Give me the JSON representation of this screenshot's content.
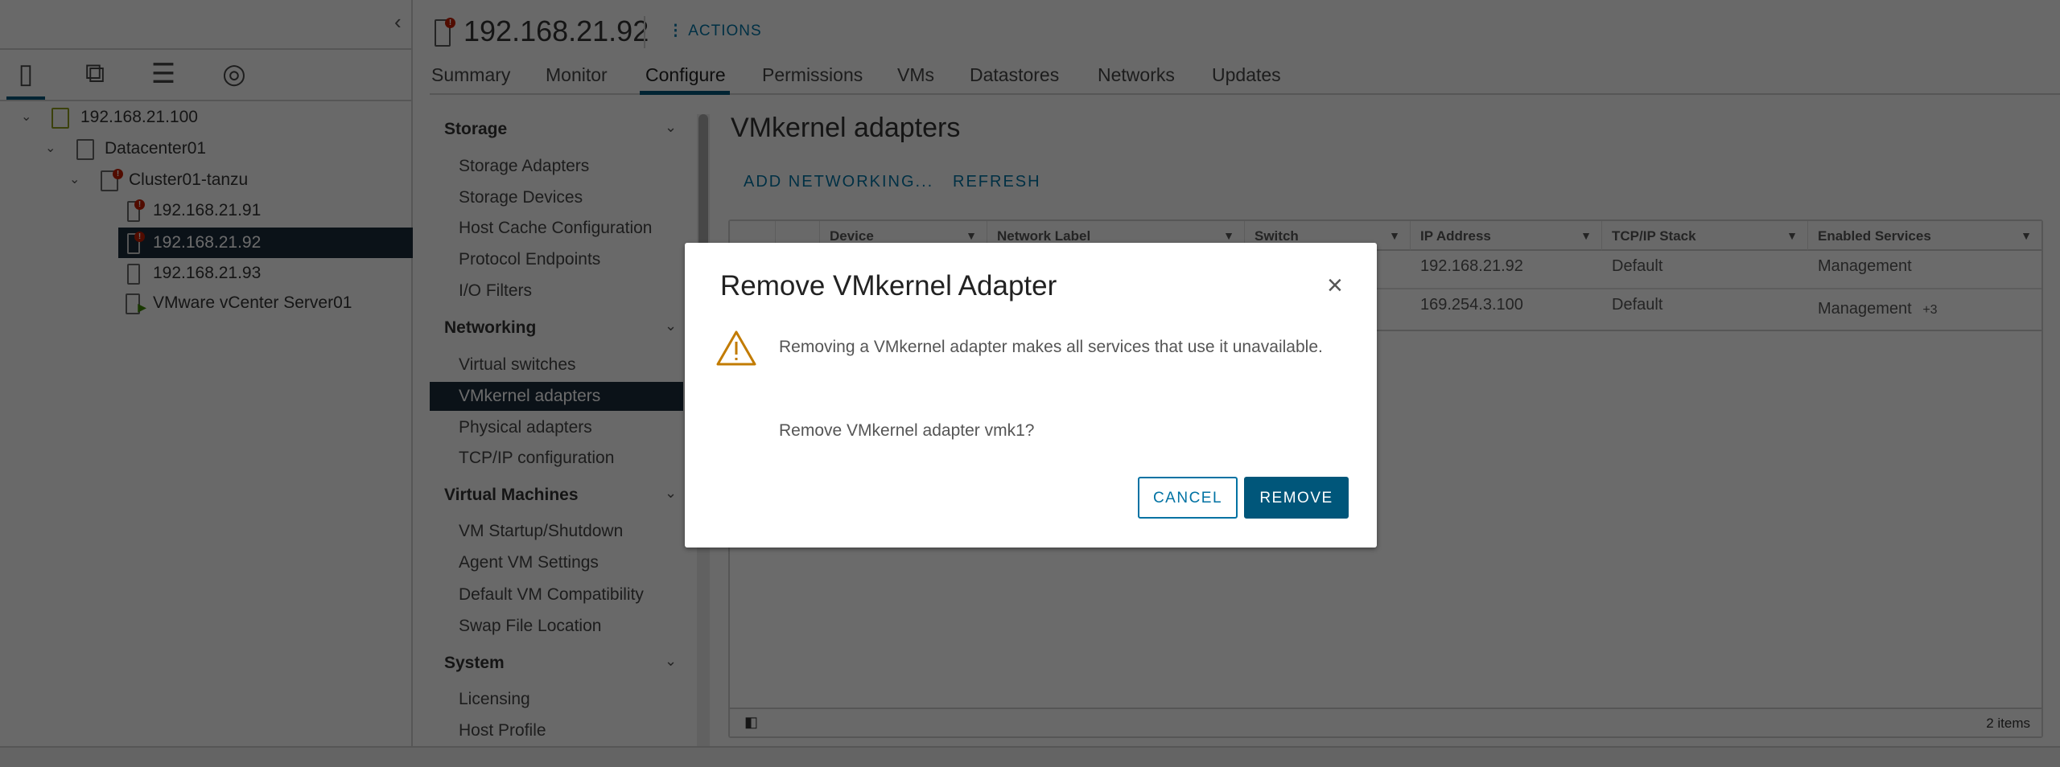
{
  "nav": {
    "collapse_icon": "chevron-left-icon",
    "view_icons": [
      "hosts-clusters-icon",
      "vms-templates-icon",
      "storage-icon",
      "networking-icon"
    ],
    "tree": [
      {
        "label": "192.168.21.100",
        "icon": "vcenter-icon"
      },
      {
        "label": "Datacenter01",
        "icon": "datacenter-icon"
      },
      {
        "label": "Cluster01-tanzu",
        "icon": "cluster-icon"
      },
      {
        "label": "192.168.21.91",
        "icon": "host-alert-icon"
      },
      {
        "label": "192.168.21.92",
        "icon": "host-alert-icon",
        "selected": true
      },
      {
        "label": "192.168.21.93",
        "icon": "host-icon"
      },
      {
        "label": "VMware vCenter Server01",
        "icon": "vm-icon"
      }
    ]
  },
  "header": {
    "title": "192.168.21.92",
    "actions": "ACTIONS"
  },
  "tabs": [
    "Summary",
    "Monitor",
    "Configure",
    "Permissions",
    "VMs",
    "Datastores",
    "Networks",
    "Updates"
  ],
  "active_tab": "Configure",
  "config_menu": {
    "storage": {
      "title": "Storage",
      "items": [
        "Storage Adapters",
        "Storage Devices",
        "Host Cache Configuration",
        "Protocol Endpoints",
        "I/O Filters"
      ]
    },
    "networking": {
      "title": "Networking",
      "items": [
        "Virtual switches",
        "VMkernel adapters",
        "Physical adapters",
        "TCP/IP configuration"
      ]
    },
    "vms": {
      "title": "Virtual Machines",
      "items": [
        "VM Startup/Shutdown",
        "Agent VM Settings",
        "Default VM Compatibility",
        "Swap File Location"
      ]
    },
    "system": {
      "title": "System",
      "items": [
        "Licensing",
        "Host Profile"
      ]
    }
  },
  "content": {
    "title": "VMkernel adapters",
    "add_networking": "ADD NETWORKING...",
    "refresh": "REFRESH",
    "columns": [
      "Device",
      "Network Label",
      "Switch",
      "IP Address",
      "TCP/IP Stack",
      "Enabled Services"
    ],
    "rows": [
      {
        "ip": "192.168.21.92",
        "stack": "Default",
        "services": "Management"
      },
      {
        "ip": "169.254.3.100",
        "stack": "Default",
        "services": "Management",
        "more": "+3"
      }
    ],
    "footer": "2 items"
  },
  "dialog": {
    "title": "Remove VMkernel Adapter",
    "message": "Removing a VMkernel adapter makes all services that use it unavailable.",
    "question": "Remove VMkernel adapter vmk1?",
    "cancel": "CANCEL",
    "remove": "REMOVE",
    "colors": {
      "primary": "#00567a",
      "warning": "#c27b00"
    }
  }
}
